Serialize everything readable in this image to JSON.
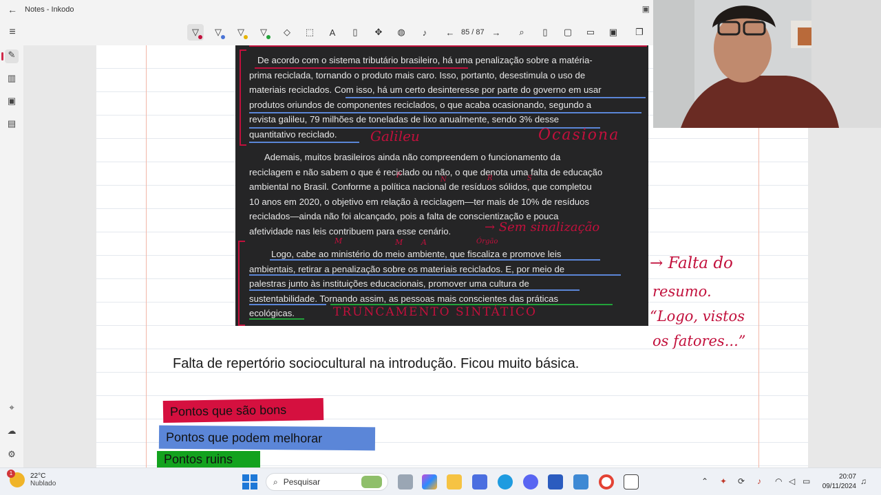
{
  "window": {
    "title": "Notes - Inkodo",
    "back_glyph": "←"
  },
  "toolbar": {
    "tools": [
      {
        "icon": "pen-red-icon",
        "glyph": "▽",
        "dot": "#c2103c"
      },
      {
        "icon": "pen-blue-icon",
        "glyph": "▽",
        "dot": "#4a74d6"
      },
      {
        "icon": "pen-yellow-icon",
        "glyph": "▽",
        "dot": "#e6b400"
      },
      {
        "icon": "pen-green-icon",
        "glyph": "▽",
        "dot": "#22a33a"
      },
      {
        "icon": "eraser-icon",
        "glyph": "◇"
      },
      {
        "icon": "lasso-select-icon",
        "glyph": "⬚"
      },
      {
        "icon": "text-icon",
        "glyph": "A"
      },
      {
        "icon": "ruler-icon",
        "glyph": "▯"
      },
      {
        "icon": "pan-icon",
        "glyph": "✥"
      },
      {
        "icon": "palette-icon",
        "glyph": "◍"
      },
      {
        "icon": "microphone-icon",
        "glyph": "♪"
      }
    ],
    "page_indicator": "85 / 87",
    "prev_glyph": "←",
    "next_glyph": "→",
    "right_tools": [
      {
        "icon": "zoom-icon",
        "glyph": "⌕"
      },
      {
        "icon": "fit-page-icon",
        "glyph": "▯"
      },
      {
        "icon": "new-page-icon",
        "glyph": "▢"
      },
      {
        "icon": "open-folder-icon",
        "glyph": "▭"
      },
      {
        "icon": "save-icon",
        "glyph": "▣"
      },
      {
        "icon": "copy-icon",
        "glyph": "❐"
      }
    ]
  },
  "sidebar": {
    "items": [
      {
        "icon": "pen-tool-icon",
        "glyph": "✎"
      },
      {
        "icon": "library-icon",
        "glyph": "▥"
      },
      {
        "icon": "slides-icon",
        "glyph": "▣"
      },
      {
        "icon": "clipboard-icon",
        "glyph": "▤"
      }
    ],
    "bottom": [
      {
        "icon": "pin-icon",
        "glyph": "⌖"
      },
      {
        "icon": "cloud-icon",
        "glyph": "☁"
      },
      {
        "icon": "settings-icon",
        "glyph": "⚙"
      }
    ]
  },
  "essay": {
    "paragraph1": [
      "De acordo com o sistema tributário brasileiro, há uma penalização sobre a matéria-",
      "prima reciclada, tornando o produto mais caro. Isso, portanto, desestimula o uso de",
      "materiais reciclados. Com isso, há um certo desinteresse por parte do governo em usar",
      "produtos oriundos de componentes reciclados, o que acaba ocasionando, segundo a",
      "revista galileu, 79 milhões de toneladas de lixo anualmente, sendo 3% desse",
      "quantitativo reciclado."
    ],
    "paragraph2": [
      "Ademais, muitos brasileiros ainda não compreendem o funcionamento da",
      "reciclagem e não sabem o que é reciclado ou não, o que denota uma falta de educação",
      "ambiental no Brasil. Conforme a política nacional de resíduos sólidos, que completou",
      "10 anos em 2020, o objetivo em relação à reciclagem—ter mais de 10% de resíduos",
      "reciclados—ainda não foi alcançado, pois a falta de conscientização e pouca",
      "afetividade nas leis contribuem para esse cenário."
    ],
    "paragraph3": [
      "Logo, cabe ao ministério do meio ambiente, que fiscaliza e promove leis",
      "ambientais, retirar a penalização sobre os materiais reciclados. E, por meio de",
      "palestras junto às instituições educacionais, promover uma cultura de",
      "sustentabilidade. Tornando assim, as pessoas mais conscientes das práticas",
      "ecológicas."
    ]
  },
  "handwriting": {
    "galileu": "Galileu",
    "ocasiona": "Ocasiona",
    "sem_sinalizacao": "→ Sem sinalização",
    "orgao": "Órgão",
    "truncamento": "TRUNCAMENTO SINTÁTICO",
    "falta_resumo": [
      "→ Falta do",
      "resumo.",
      "“Logo, vistos",
      "os fatores...”"
    ],
    "marks_p2": [
      "P",
      "N",
      "R",
      "S"
    ],
    "marks_p3": [
      "M",
      "M",
      "A"
    ]
  },
  "comment": "Falta de repertório sociocultural na introdução. Ficou muito básica.",
  "legend": [
    {
      "label": "Pontos que são bons",
      "color": "#d5103f"
    },
    {
      "label": "Pontos que podem melhorar",
      "color": "#5b86d8"
    },
    {
      "label": "Pontos ruins",
      "color": "#13a21e"
    }
  ],
  "taskbar": {
    "weather_temp": "22°C",
    "weather_desc": "Nublado",
    "weather_badge": "1",
    "search_placeholder": "Pesquisar",
    "apps": [
      "widgets-icon",
      "files-icon",
      "copilot-icon",
      "file-explorer-icon",
      "store-icon",
      "edge-icon",
      "discord-icon",
      "word-icon",
      "photos-icon",
      "chrome-icon",
      "inkodo-icon"
    ],
    "time": "20:07",
    "date": "09/11/2024"
  }
}
